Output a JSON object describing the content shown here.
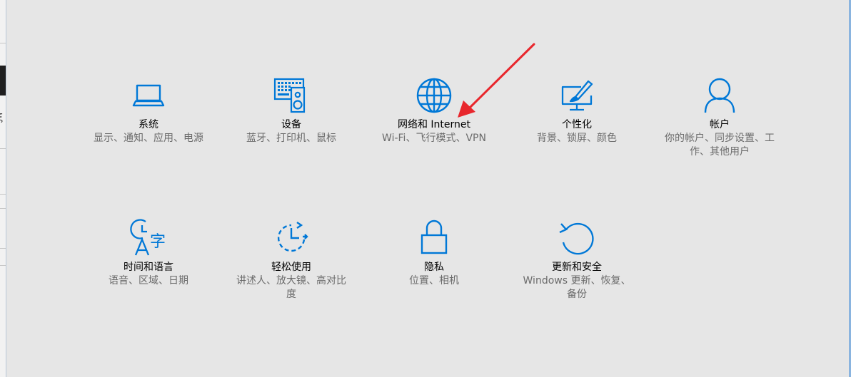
{
  "left_edge": {
    "glyph": "ξ"
  },
  "settings": [
    {
      "title": "系统",
      "desc": "显示、通知、应用、电源",
      "icon": "laptop-icon"
    },
    {
      "title": "设备",
      "desc": "蓝牙、打印机、鼠标",
      "icon": "devices-icon"
    },
    {
      "title": "网络和 Internet",
      "desc": "Wi-Fi、飞行模式、VPN",
      "icon": "globe-icon"
    },
    {
      "title": "个性化",
      "desc": "背景、锁屏、颜色",
      "icon": "personalization-icon"
    },
    {
      "title": "帐户",
      "desc": "你的帐户、同步设置、工作、其他用户",
      "icon": "account-icon"
    },
    {
      "title": "时间和语言",
      "desc": "语音、区域、日期",
      "icon": "time-language-icon"
    },
    {
      "title": "轻松使用",
      "desc": "讲述人、放大镜、高对比度",
      "icon": "ease-of-access-icon"
    },
    {
      "title": "隐私",
      "desc": "位置、相机",
      "icon": "lock-icon"
    },
    {
      "title": "更新和安全",
      "desc": "Windows 更新、恢复、备份",
      "icon": "update-icon"
    }
  ],
  "colors": {
    "accent": "#0078d7",
    "annotation_arrow": "#e8272d",
    "background": "#e6e6e6"
  }
}
